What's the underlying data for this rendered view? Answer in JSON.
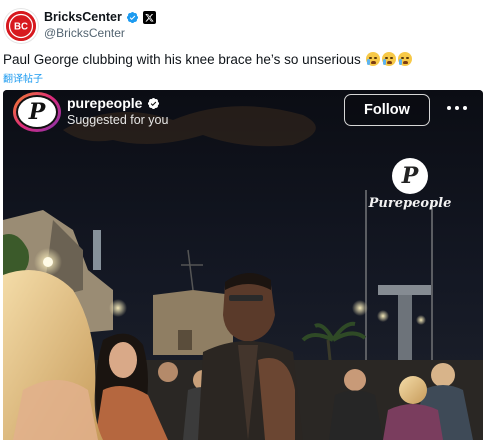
{
  "tweet": {
    "display_name": "BricksCenter",
    "handle": "@BricksCenter",
    "avatar_text": "BC",
    "text": "Paul George clubbing with his knee brace he’s so unserious",
    "emoji_count": 3,
    "translate_label": "翻译帖子"
  },
  "embedded_post": {
    "account_name": "purepeople",
    "subtitle": "Suggested for you",
    "follow_label": "Follow",
    "avatar_letter": "P",
    "watermark_letter": "P",
    "watermark_text": "Purepeople"
  },
  "colors": {
    "verified_blue": "#1d9bf0",
    "brand_red": "#d7191f",
    "link_blue": "#1d9bf0"
  },
  "icons": {
    "verified": "verified-badge-icon",
    "affiliate": "x-affiliate-icon",
    "more": "more-options-icon"
  }
}
